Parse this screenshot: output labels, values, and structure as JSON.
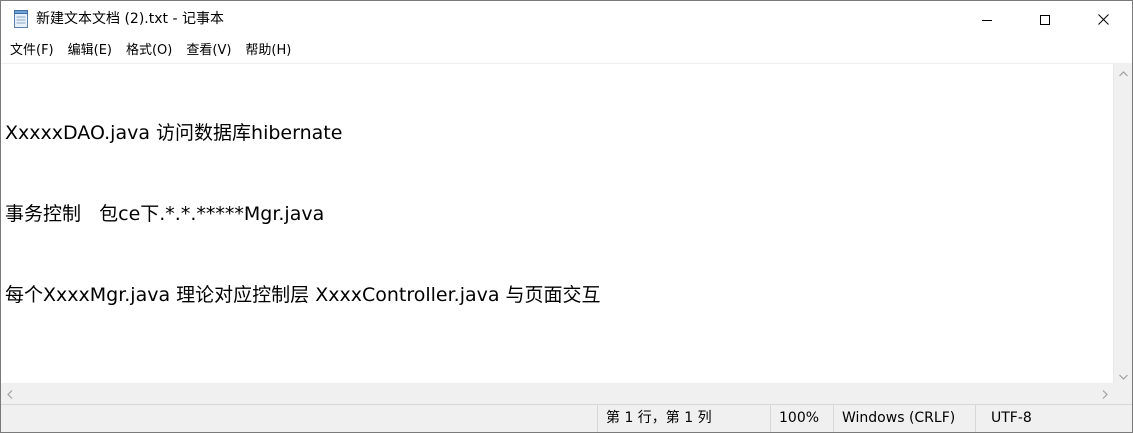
{
  "window": {
    "title": "新建文本文档 (2).txt - 记事本",
    "icon": "notepad-icon"
  },
  "caption_buttons": {
    "minimize": "minimize-icon",
    "maximize": "maximize-icon",
    "close": "close-icon"
  },
  "menu": {
    "items": [
      {
        "label": "文件(F)"
      },
      {
        "label": "编辑(E)"
      },
      {
        "label": "格式(O)"
      },
      {
        "label": "查看(V)"
      },
      {
        "label": "帮助(H)"
      }
    ]
  },
  "editor": {
    "lines": [
      "XxxxxDAO.java 访问数据库hibernate",
      "事务控制   包ce下.*.*.*****Mgr.java",
      "每个XxxxMgr.java 理论对应控制层 XxxxController.java 与页面交互"
    ]
  },
  "statusbar": {
    "position": "第 1 行，第 1 列",
    "zoom": "100%",
    "line_ending": "Windows (CRLF)",
    "encoding": "UTF-8"
  },
  "colors": {
    "chrome_background": "#f0f0f0",
    "border": "#7a7a7a",
    "text": "#000000"
  }
}
